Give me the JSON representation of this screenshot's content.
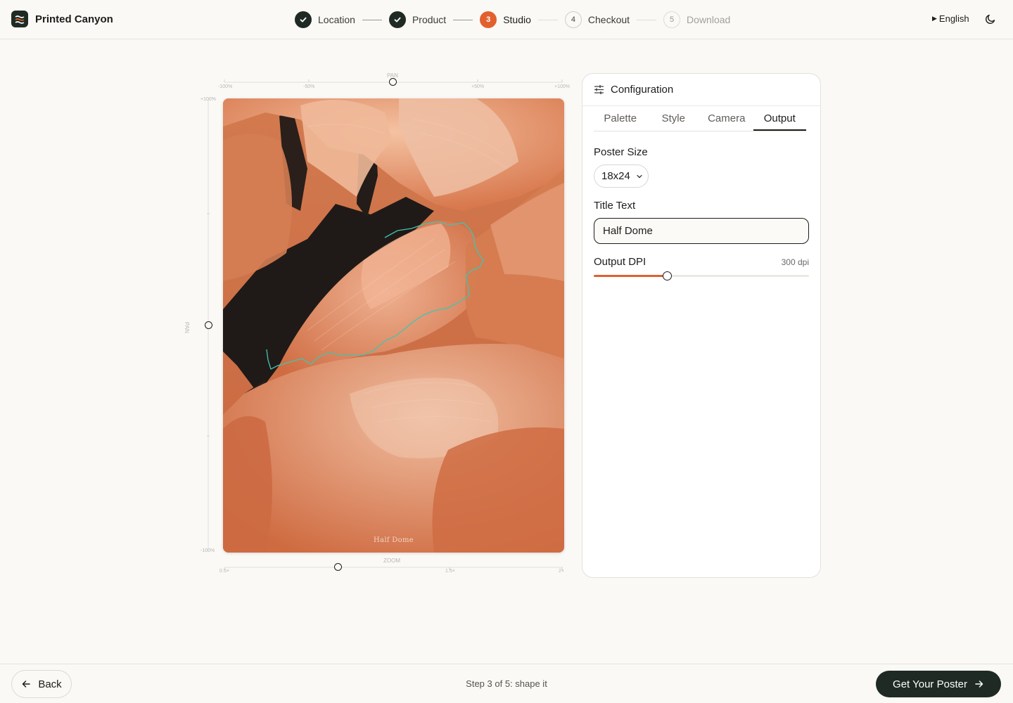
{
  "app": {
    "name": "Printed Canyon"
  },
  "stepper": {
    "steps": [
      {
        "label": "Location",
        "state": "done"
      },
      {
        "label": "Product",
        "state": "done"
      },
      {
        "number": "3",
        "label": "Studio",
        "state": "active"
      },
      {
        "number": "4",
        "label": "Checkout",
        "state": "todo"
      },
      {
        "number": "5",
        "label": "Download",
        "state": "disabled"
      }
    ]
  },
  "header": {
    "language": "English",
    "theme_icon": "moon-icon"
  },
  "canvas": {
    "top_ruler": {
      "label": "PAN",
      "ticks": [
        "-100%",
        "-50%",
        "+50%",
        "+100%"
      ]
    },
    "left_ruler": {
      "label": "PAN",
      "ticks": [
        "+100%",
        "-100%"
      ]
    },
    "bottom_ruler": {
      "label": "ZOOM",
      "ticks": [
        "0.5×",
        "1.5×",
        "2×"
      ]
    },
    "poster_title": "Half Dome",
    "trail_color": "#40c4b2"
  },
  "config": {
    "title": "Configuration",
    "tabs": [
      "Palette",
      "Style",
      "Camera",
      "Output"
    ],
    "active_tab": "Output",
    "poster_size": {
      "label": "Poster Size",
      "value": "18x24"
    },
    "title_text": {
      "label": "Title Text",
      "value": "Half Dome"
    },
    "output_dpi": {
      "label": "Output DPI",
      "value_text": "300 dpi",
      "fill_fraction": 0.34
    }
  },
  "footer": {
    "back_label": "Back",
    "status": "Step 3 of 5: shape it",
    "cta_label": "Get Your Poster"
  },
  "colors": {
    "accent": "#e2602d",
    "dark": "#1f2a24",
    "terrain": "#d8764f"
  }
}
